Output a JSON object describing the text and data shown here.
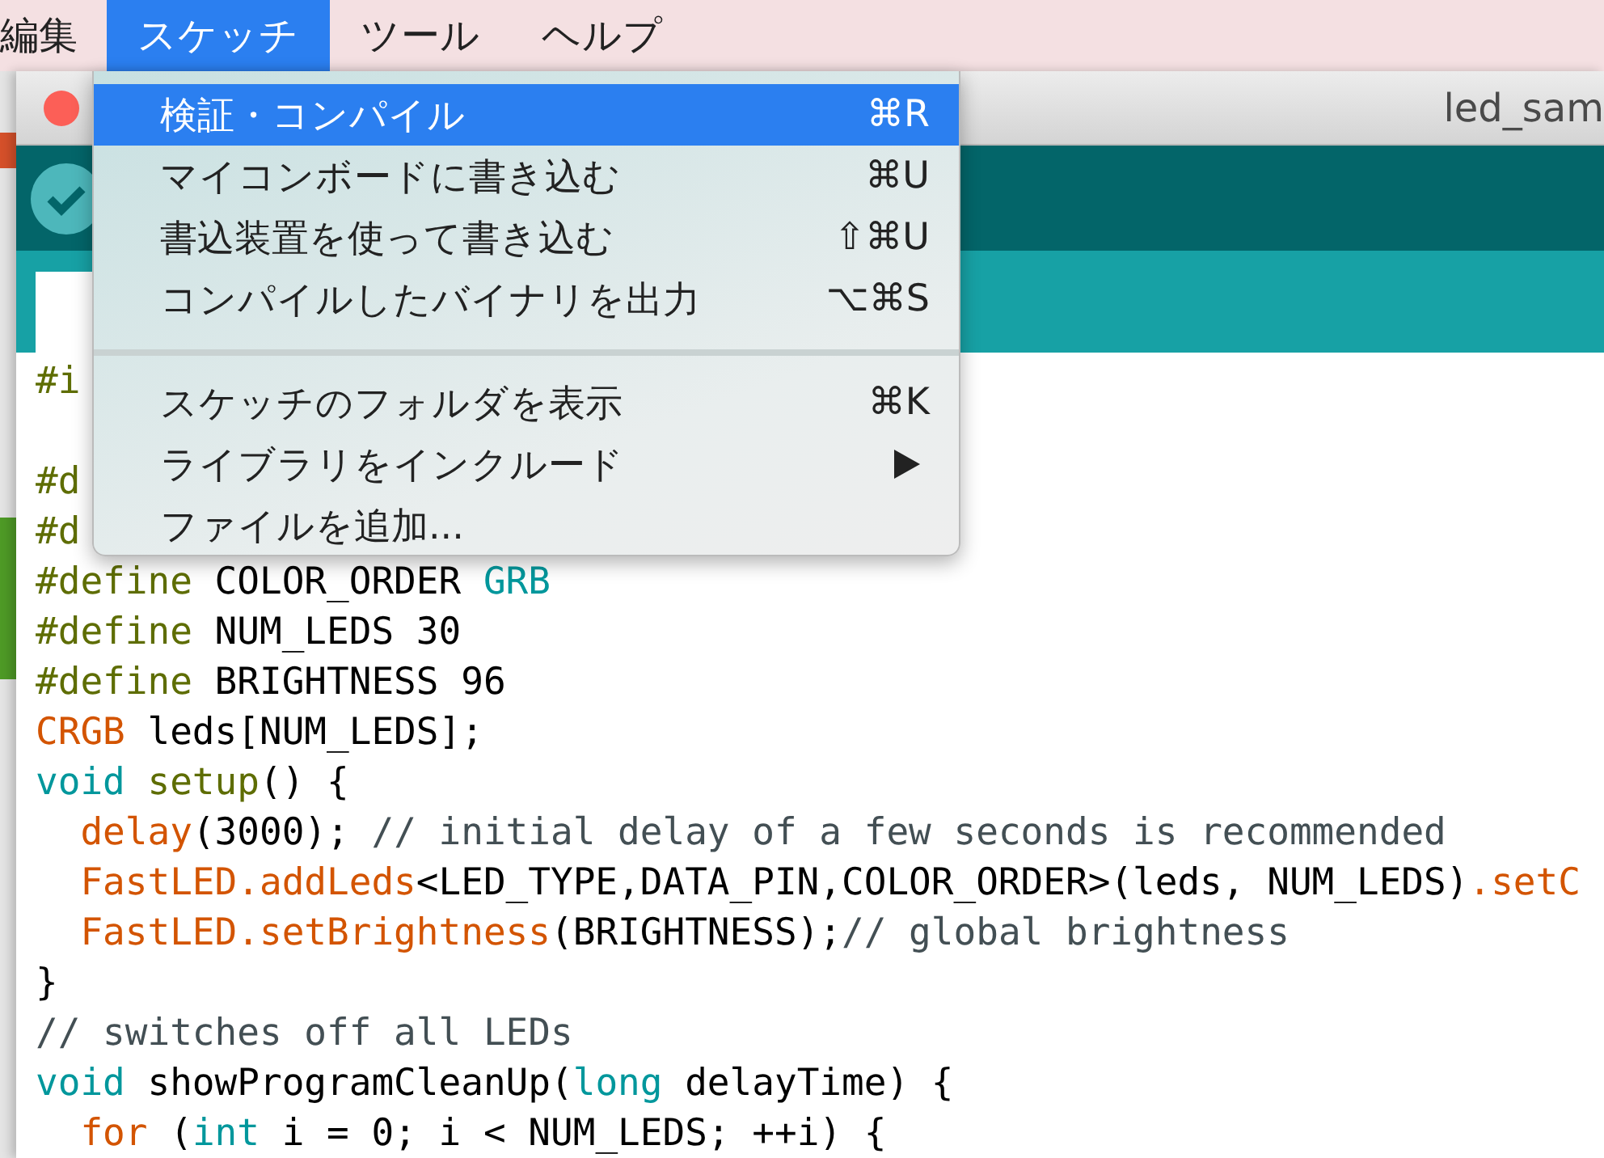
{
  "menu_bar": {
    "items": [
      {
        "label": "編集",
        "selected": false
      },
      {
        "label": "スケッチ",
        "selected": true
      },
      {
        "label": "ツール",
        "selected": false
      },
      {
        "label": "ヘルプ",
        "selected": false
      }
    ]
  },
  "window": {
    "title": "led_sam"
  },
  "dropdown": {
    "items": [
      {
        "kind": "item",
        "label": "検証・コンパイル",
        "shortcut": "⌘R",
        "selected": true,
        "submenu": false
      },
      {
        "kind": "item",
        "label": "マイコンボードに書き込む",
        "shortcut": "⌘U",
        "selected": false,
        "submenu": false
      },
      {
        "kind": "item",
        "label": "書込装置を使って書き込む",
        "shortcut": "⇧⌘U",
        "selected": false,
        "submenu": false
      },
      {
        "kind": "item",
        "label": "コンパイルしたバイナリを出力",
        "shortcut": "⌥⌘S",
        "selected": false,
        "submenu": false
      },
      {
        "kind": "separator"
      },
      {
        "kind": "item",
        "label": "スケッチのフォルダを表示",
        "shortcut": "⌘K",
        "selected": false,
        "submenu": false
      },
      {
        "kind": "item",
        "label": "ライブラリをインクルード",
        "selected": false,
        "submenu": true
      },
      {
        "kind": "item",
        "label": "ファイルを追加...",
        "selected": false,
        "submenu": false
      }
    ]
  },
  "editor": {
    "lines": [
      {
        "kind": "code",
        "segments": [
          {
            "t": "#i",
            "kind": "directive"
          }
        ]
      },
      {
        "kind": "blank"
      },
      {
        "kind": "code",
        "segments": [
          {
            "t": "#d",
            "kind": "directive"
          }
        ]
      },
      {
        "kind": "code",
        "segments": [
          {
            "t": "#d",
            "kind": "directive"
          }
        ]
      },
      {
        "kind": "code",
        "segments": [
          {
            "t": "#define",
            "kind": "directive"
          },
          {
            "t": " COLOR_ORDER ",
            "kind": "plain"
          },
          {
            "t": "GRB",
            "kind": "keyword"
          }
        ]
      },
      {
        "kind": "code",
        "segments": [
          {
            "t": "#define",
            "kind": "directive"
          },
          {
            "t": " NUM_LEDS 30",
            "kind": "plain"
          }
        ]
      },
      {
        "kind": "code",
        "segments": [
          {
            "t": "#define",
            "kind": "directive"
          },
          {
            "t": " BRIGHTNESS 96",
            "kind": "plain"
          }
        ]
      },
      {
        "kind": "code",
        "segments": [
          {
            "t": "CRGB",
            "kind": "function"
          },
          {
            "t": " leds[NUM_LEDS];",
            "kind": "plain"
          }
        ]
      },
      {
        "kind": "code",
        "segments": [
          {
            "t": "void",
            "kind": "keyword"
          },
          {
            "t": " setup",
            "kind": "directive"
          },
          {
            "t": "() {",
            "kind": "plain"
          }
        ]
      },
      {
        "kind": "code",
        "segments": [
          {
            "t": "  delay",
            "kind": "function"
          },
          {
            "t": "(3000); ",
            "kind": "plain"
          },
          {
            "t": "// initial delay of a few seconds is recommended",
            "kind": "comment"
          }
        ]
      },
      {
        "kind": "code",
        "segments": [
          {
            "t": "  FastLED.addLeds",
            "kind": "function"
          },
          {
            "t": "<LED_TYPE,DATA_PIN,COLOR_ORDER>(leds, NUM_LEDS)",
            "kind": "plain"
          },
          {
            "t": ".setC",
            "kind": "function"
          }
        ]
      },
      {
        "kind": "code",
        "segments": [
          {
            "t": "  FastLED.setBrightness",
            "kind": "function"
          },
          {
            "t": "(BRIGHTNESS);",
            "kind": "plain"
          },
          {
            "t": "// global brightness",
            "kind": "comment"
          }
        ]
      },
      {
        "kind": "code",
        "segments": [
          {
            "t": "}",
            "kind": "plain"
          }
        ]
      },
      {
        "kind": "code",
        "segments": [
          {
            "t": "// switches off all LEDs",
            "kind": "comment"
          }
        ]
      },
      {
        "kind": "code",
        "segments": [
          {
            "t": "void",
            "kind": "keyword"
          },
          {
            "t": " showProgramCleanUp(",
            "kind": "plain"
          },
          {
            "t": "long",
            "kind": "keyword"
          },
          {
            "t": " delayTime) {",
            "kind": "plain"
          }
        ]
      },
      {
        "kind": "code",
        "segments": [
          {
            "t": "  for",
            "kind": "function"
          },
          {
            "t": " (",
            "kind": "plain"
          },
          {
            "t": "int",
            "kind": "keyword"
          },
          {
            "t": " i = 0; i < NUM_LEDS; ++i) {",
            "kind": "plain"
          }
        ]
      }
    ]
  }
}
